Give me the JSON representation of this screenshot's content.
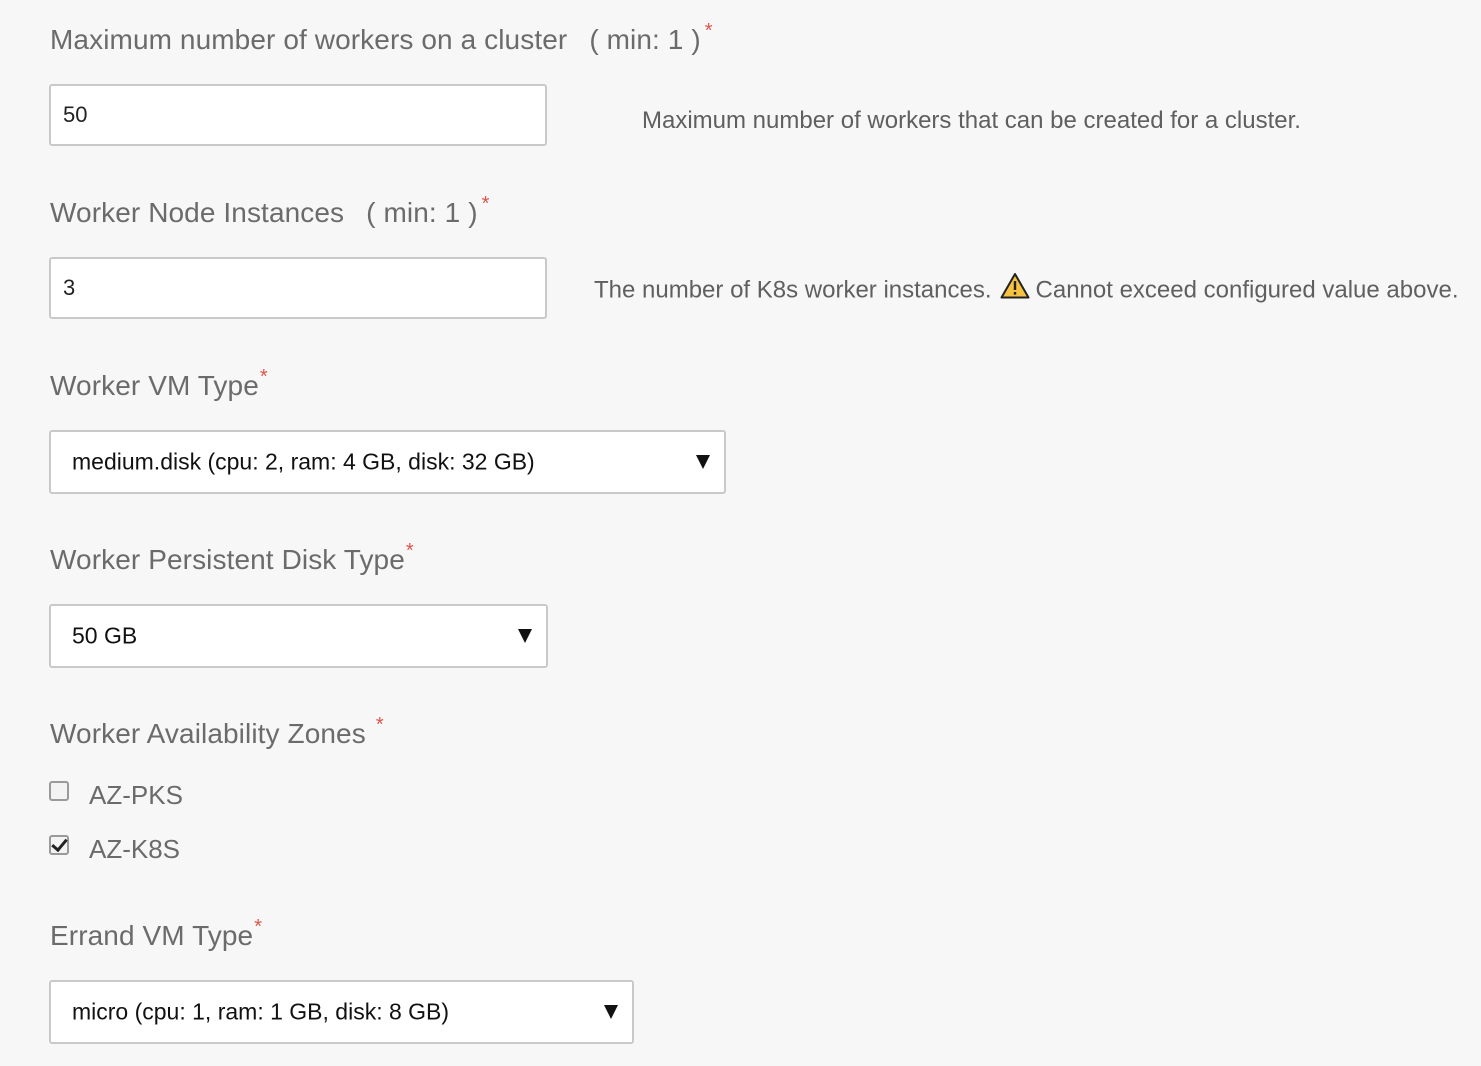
{
  "max_workers": {
    "label": "Maximum number of workers on a cluster",
    "constraint": "( min: 1 )",
    "required_mark": "*",
    "value": "50",
    "hint": "Maximum number of workers that can be created for a cluster."
  },
  "worker_instances": {
    "label": "Worker Node Instances",
    "constraint": "( min: 1 )",
    "required_mark": "*",
    "value": "3",
    "hint_before": "The number of K8s worker instances.",
    "hint_after": "Cannot exceed configured value above."
  },
  "worker_vm_type": {
    "label": "Worker VM Type",
    "required_mark": "*",
    "selected": "medium.disk (cpu: 2, ram: 4 GB, disk: 32 GB)"
  },
  "worker_disk_type": {
    "label": "Worker Persistent Disk Type",
    "required_mark": "*",
    "selected": "50 GB"
  },
  "worker_azs": {
    "label": "Worker Availability Zones",
    "required_mark": "*",
    "options": [
      {
        "label": "AZ-PKS",
        "checked": false
      },
      {
        "label": "AZ-K8S",
        "checked": true
      }
    ]
  },
  "errand_vm_type": {
    "label": "Errand VM Type",
    "required_mark": "*",
    "selected": "micro (cpu: 1, ram: 1 GB, disk: 8 GB)"
  },
  "colors": {
    "required": "#e0544a",
    "warning": "#f5c242",
    "label": "#6b6b6b"
  },
  "icons": {
    "warning": "warning-icon",
    "dropdown": "caret-down-icon",
    "checkmark": "check-icon"
  }
}
